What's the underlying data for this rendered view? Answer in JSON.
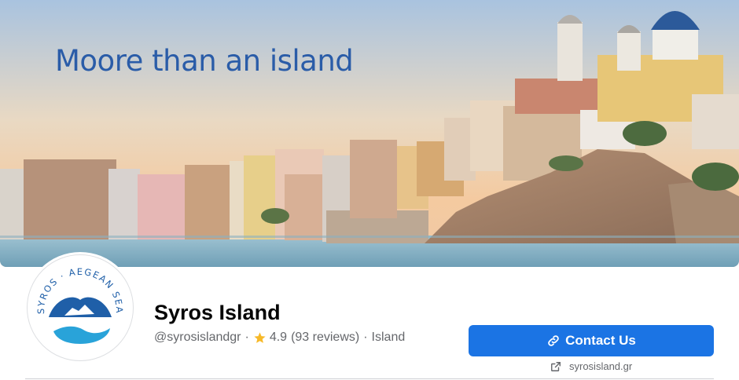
{
  "cover": {
    "tagline": "Moore than an island"
  },
  "profile": {
    "name": "Syros Island",
    "handle": "@syrosislandgr",
    "separator": "·",
    "rating": "4.9",
    "reviews": "(93 reviews)",
    "category": "Island"
  },
  "logo": {
    "text_top": "SYROS · AEGEAN SEA"
  },
  "actions": {
    "contact_label": "Contact Us",
    "website": "syrosisland.gr"
  },
  "colors": {
    "primary_button": "#1b74e4",
    "tagline": "#2a5ca8",
    "secondary_text": "#65676b",
    "rating_star": "#f7b928"
  },
  "icons": {
    "star": "star-icon",
    "link": "link-icon",
    "external": "external-link-icon"
  }
}
